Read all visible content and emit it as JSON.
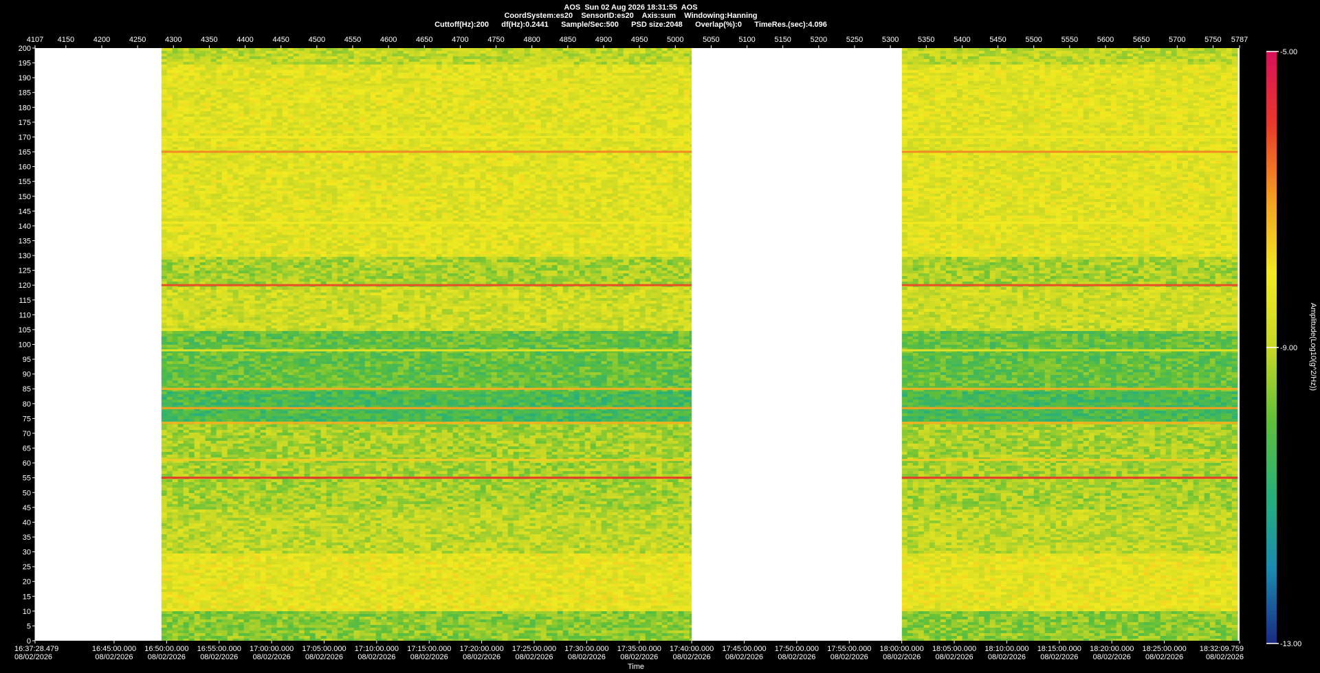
{
  "header": {
    "line1": "AOS  Sun 02 Aug 2026 18:31:55  AOS",
    "line2": "CoordSystem:es20    SensorID:es20    Axis:sum    Windowing:Hanning",
    "line3": "Cuttoff(Hz):200      df(Hz):0.2441      Sample/Sec:500      PSD size:2048      Overlap(%):0      TimeRes.(sec):4.096"
  },
  "chart_data": {
    "type": "heatmap",
    "title": "AOS  Sun 02 Aug 2026 18:31:55  AOS",
    "xlabel": "Time",
    "ylabel": "",
    "colorbar_label": "Amplitude(Log10(g^2/Hz))",
    "colorbar_range": [
      -13.0,
      -5.0
    ],
    "colorbar_ticks": [
      "-5.00",
      "-9.00",
      "-13.00"
    ],
    "colorscale": [
      "#1a2a80",
      "#1a8ab0",
      "#27b07a",
      "#5fbf3a",
      "#c8d825",
      "#f2ea20",
      "#f2a020",
      "#e83a2a",
      "#d8105a"
    ],
    "ylim": [
      0,
      200
    ],
    "y_ticks": [
      200,
      195,
      190,
      185,
      180,
      175,
      170,
      165,
      160,
      155,
      150,
      145,
      140,
      135,
      130,
      125,
      120,
      115,
      110,
      105,
      100,
      95,
      90,
      85,
      80,
      75,
      70,
      65,
      60,
      55,
      50,
      45,
      40,
      35,
      30,
      25,
      20,
      15,
      10,
      5,
      0
    ],
    "top_axis_range": [
      4107,
      5787
    ],
    "top_ticks": [
      "4107",
      "4150",
      "4200",
      "4250",
      "4300",
      "4350",
      "4400",
      "4450",
      "4500",
      "4550",
      "4600",
      "4650",
      "4700",
      "4750",
      "4800",
      "4850",
      "4900",
      "4950",
      "5000",
      "5050",
      "5100",
      "5150",
      "5200",
      "5250",
      "5300",
      "5350",
      "5400",
      "5450",
      "5500",
      "5550",
      "5600",
      "5650",
      "5700",
      "5750",
      "5787"
    ],
    "time_ticks": [
      {
        "time": "16:37:28.479",
        "date": "08/02/2026"
      },
      {
        "time": "16:45:00.000",
        "date": "08/02/2026"
      },
      {
        "time": "16:50:00.000",
        "date": "08/02/2026"
      },
      {
        "time": "16:55:00.000",
        "date": "08/02/2026"
      },
      {
        "time": "17:00:00.000",
        "date": "08/02/2026"
      },
      {
        "time": "17:05:00.000",
        "date": "08/02/2026"
      },
      {
        "time": "17:10:00.000",
        "date": "08/02/2026"
      },
      {
        "time": "17:15:00.000",
        "date": "08/02/2026"
      },
      {
        "time": "17:20:00.000",
        "date": "08/02/2026"
      },
      {
        "time": "17:25:00.000",
        "date": "08/02/2026"
      },
      {
        "time": "17:30:00.000",
        "date": "08/02/2026"
      },
      {
        "time": "17:35:00.000",
        "date": "08/02/2026"
      },
      {
        "time": "17:40:00.000",
        "date": "08/02/2026"
      },
      {
        "time": "17:45:00.000",
        "date": "08/02/2026"
      },
      {
        "time": "17:50:00.000",
        "date": "08/02/2026"
      },
      {
        "time": "17:55:00.000",
        "date": "08/02/2026"
      },
      {
        "time": "18:00:00.000",
        "date": "08/02/2026"
      },
      {
        "time": "18:05:00.000",
        "date": "08/02/2026"
      },
      {
        "time": "18:10:00.000",
        "date": "08/02/2026"
      },
      {
        "time": "18:15:00.000",
        "date": "08/02/2026"
      },
      {
        "time": "18:20:00.000",
        "date": "08/02/2026"
      },
      {
        "time": "18:25:00.000",
        "date": "08/02/2026"
      },
      {
        "time": "18:32:09.759",
        "date": "08/02/2026"
      }
    ],
    "data_segments": [
      {
        "start": "16:49:30",
        "end": "17:40:00"
      },
      {
        "start": "18:00:00",
        "end": "18:32:00"
      }
    ],
    "tonal_lines_hz": [
      {
        "hz": 165,
        "level": -6.8
      },
      {
        "hz": 120,
        "level": -6.2
      },
      {
        "hz": 85,
        "level": -7.2
      },
      {
        "hz": 78.5,
        "level": -7.0
      },
      {
        "hz": 73.5,
        "level": -7.2
      },
      {
        "hz": 61,
        "level": -7.6
      },
      {
        "hz": 55,
        "level": -6.0
      },
      {
        "hz": 170,
        "level": -8.0
      },
      {
        "hz": 141,
        "level": -8.0
      },
      {
        "hz": 187,
        "level": -8.4
      },
      {
        "hz": 98,
        "level": -8.4
      }
    ]
  }
}
